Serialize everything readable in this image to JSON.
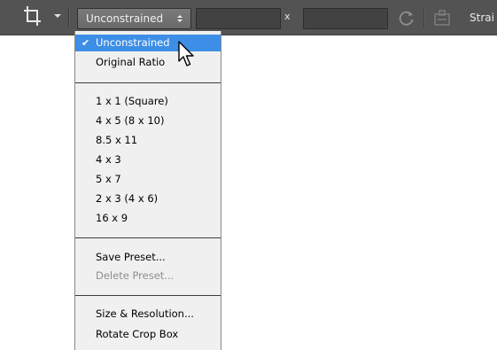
{
  "options_bar": {
    "tool_icon": "crop-icon",
    "ratio_select_value": "Unconstrained",
    "width_value": "",
    "height_value": "",
    "times_label": "x",
    "swap_icon": "rotate-swap-icon",
    "straighten_icon": "straighten-icon",
    "straighten_label": "Strai"
  },
  "menu": {
    "items": [
      {
        "label": "Unconstrained",
        "checked": true,
        "selected": true
      },
      {
        "label": "Original Ratio"
      },
      {
        "label": "1 x 1 (Square)"
      },
      {
        "label": "4 x 5 (8 x 10)"
      },
      {
        "label": "8.5 x 11"
      },
      {
        "label": "4 x 3"
      },
      {
        "label": "5 x 7"
      },
      {
        "label": "2 x 3 (4 x 6)"
      },
      {
        "label": "16 x 9"
      },
      {
        "label": "Save Preset..."
      },
      {
        "label": "Delete Preset...",
        "disabled": true
      },
      {
        "label": "Size & Resolution..."
      },
      {
        "label": "Rotate Crop Box"
      }
    ],
    "check_glyph": "✔"
  },
  "colors": {
    "toolbar_bg": "#535353",
    "menu_bg": "#f0f0f0",
    "selection": "#3d8ee6",
    "disabled_text": "#8e8e8e"
  }
}
